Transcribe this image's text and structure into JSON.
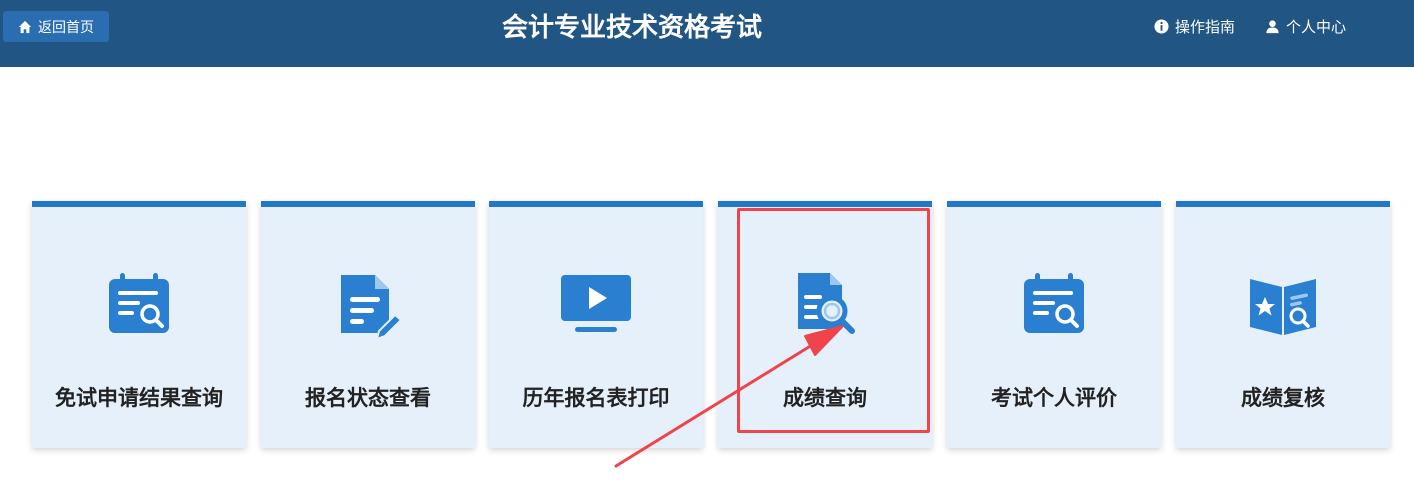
{
  "header": {
    "home_label": "返回首页",
    "title": "会计专业技术资格考试",
    "guide_label": "操作指南",
    "personal_label": "个人中心",
    "background_color": "#215583"
  },
  "cards": [
    {
      "label": "免试申请结果查询",
      "icon": "calendar-search-icon"
    },
    {
      "label": "报名状态查看",
      "icon": "document-edit-icon"
    },
    {
      "label": "历年报名表打印",
      "icon": "video-screen-icon"
    },
    {
      "label": "成绩查询",
      "icon": "document-search-icon",
      "highlighted": true
    },
    {
      "label": "考试个人评价",
      "icon": "calendar-search-icon"
    },
    {
      "label": "成绩复核",
      "icon": "book-star-search-icon"
    }
  ],
  "colors": {
    "card_background": "#e5f0fb",
    "card_accent": "#2277c7",
    "highlight": "#f0444c"
  }
}
